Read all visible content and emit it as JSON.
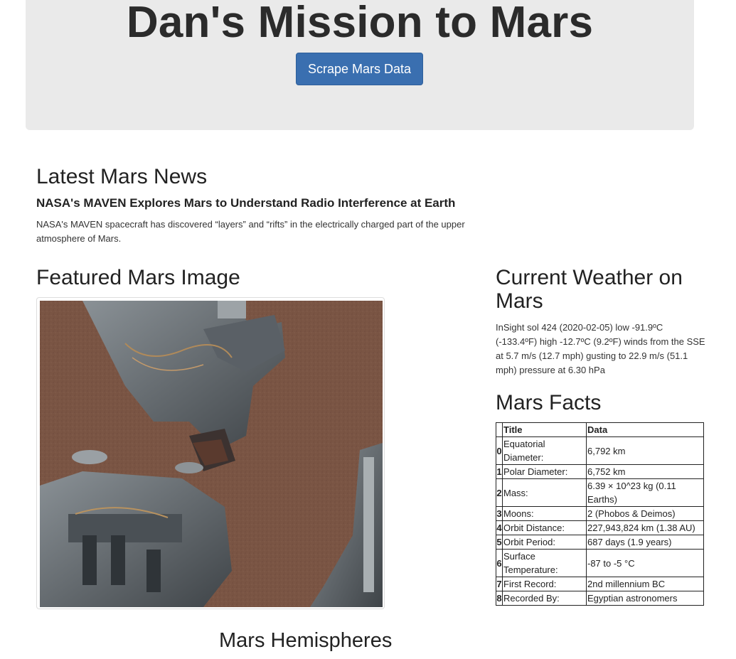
{
  "header": {
    "title": "Dan's Mission to Mars",
    "scrape_button": "Scrape Mars Data"
  },
  "news": {
    "heading": "Latest Mars News",
    "title": "NASA's MAVEN Explores Mars to Understand Radio Interference at Earth",
    "body": "NASA's MAVEN spacecraft has discovered “layers” and “rifts” in the electrically charged part of the upper atmosphere of Mars."
  },
  "featured": {
    "heading": "Featured Mars Image"
  },
  "weather": {
    "heading": "Current Weather on Mars",
    "text": "InSight sol 424 (2020-02-05) low -91.9ºC (-133.4ºF) high -12.7ºC (9.2ºF) winds from the SSE at 5.7 m/s (12.7 mph) gusting to 22.9 m/s (51.1 mph) pressure at 6.30 hPa"
  },
  "facts": {
    "heading": "Mars Facts",
    "columns": [
      "Title",
      "Data"
    ],
    "rows": [
      {
        "index": "0",
        "title": "Equatorial Diameter:",
        "data": "6,792 km"
      },
      {
        "index": "1",
        "title": "Polar Diameter:",
        "data": "6,752 km"
      },
      {
        "index": "2",
        "title": "Mass:",
        "data": "6.39 × 10^23 kg (0.11 Earths)"
      },
      {
        "index": "3",
        "title": "Moons:",
        "data": "2 (Phobos & Deimos)"
      },
      {
        "index": "4",
        "title": "Orbit Distance:",
        "data": "227,943,824 km (1.38 AU)"
      },
      {
        "index": "5",
        "title": "Orbit Period:",
        "data": "687 days (1.9 years)"
      },
      {
        "index": "6",
        "title": "Surface Temperature:",
        "data": "-87 to -5 °C"
      },
      {
        "index": "7",
        "title": "First Record:",
        "data": "2nd millennium BC"
      },
      {
        "index": "8",
        "title": "Recorded By:",
        "data": "Egyptian astronomers"
      }
    ]
  },
  "hemispheres": {
    "heading": "Mars Hemispheres"
  }
}
